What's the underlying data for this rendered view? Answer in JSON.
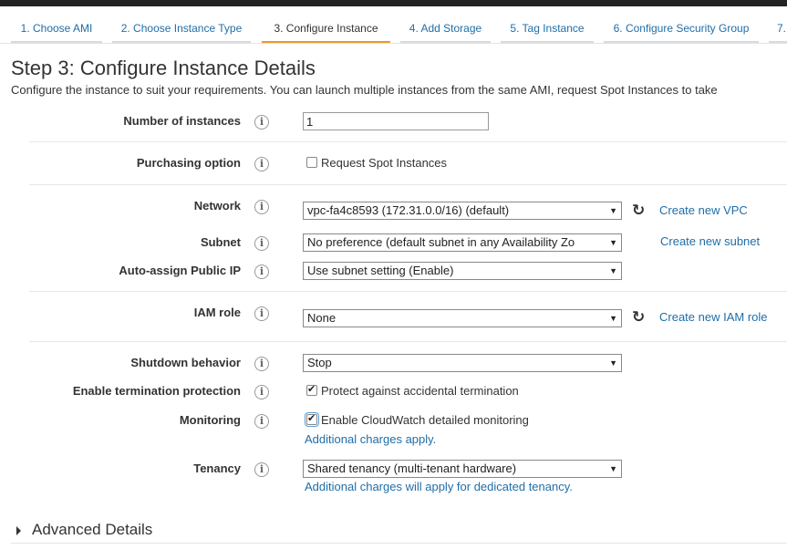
{
  "tabs": [
    {
      "label": "1. Choose AMI"
    },
    {
      "label": "2. Choose Instance Type"
    },
    {
      "label": "3. Configure Instance"
    },
    {
      "label": "4. Add Storage"
    },
    {
      "label": "5. Tag Instance"
    },
    {
      "label": "6. Configure Security Group"
    },
    {
      "label": "7."
    }
  ],
  "page": {
    "title": "Step 3: Configure Instance Details",
    "description": "Configure the instance to suit your requirements. You can launch multiple instances from the same AMI, request Spot Instances to take"
  },
  "form": {
    "instances": {
      "label": "Number of instances",
      "value": "1"
    },
    "purchasing": {
      "label": "Purchasing option",
      "checkbox_label": "Request Spot Instances",
      "checked": false
    },
    "network": {
      "label": "Network",
      "value": "vpc-fa4c8593 (172.31.0.0/16) (default)",
      "link": "Create new VPC"
    },
    "subnet": {
      "label": "Subnet",
      "value": "No preference (default subnet in any Availability Zo",
      "link": "Create new subnet"
    },
    "public_ip": {
      "label": "Auto-assign Public IP",
      "value": "Use subnet setting (Enable)"
    },
    "iam": {
      "label": "IAM role",
      "value": "None",
      "link": "Create new IAM role"
    },
    "shutdown": {
      "label": "Shutdown behavior",
      "value": "Stop"
    },
    "termination": {
      "label": "Enable termination protection",
      "checkbox_label": "Protect against accidental termination",
      "checked": true
    },
    "monitoring": {
      "label": "Monitoring",
      "checkbox_label": "Enable CloudWatch detailed monitoring",
      "checked": true,
      "link": "Additional charges apply."
    },
    "tenancy": {
      "label": "Tenancy",
      "value": "Shared tenancy (multi-tenant hardware)",
      "link": "Additional charges will apply for dedicated tenancy."
    }
  },
  "advanced": {
    "label": "Advanced Details"
  },
  "icons": {
    "info": "i",
    "refresh": "↻",
    "dropdown": "▼"
  }
}
